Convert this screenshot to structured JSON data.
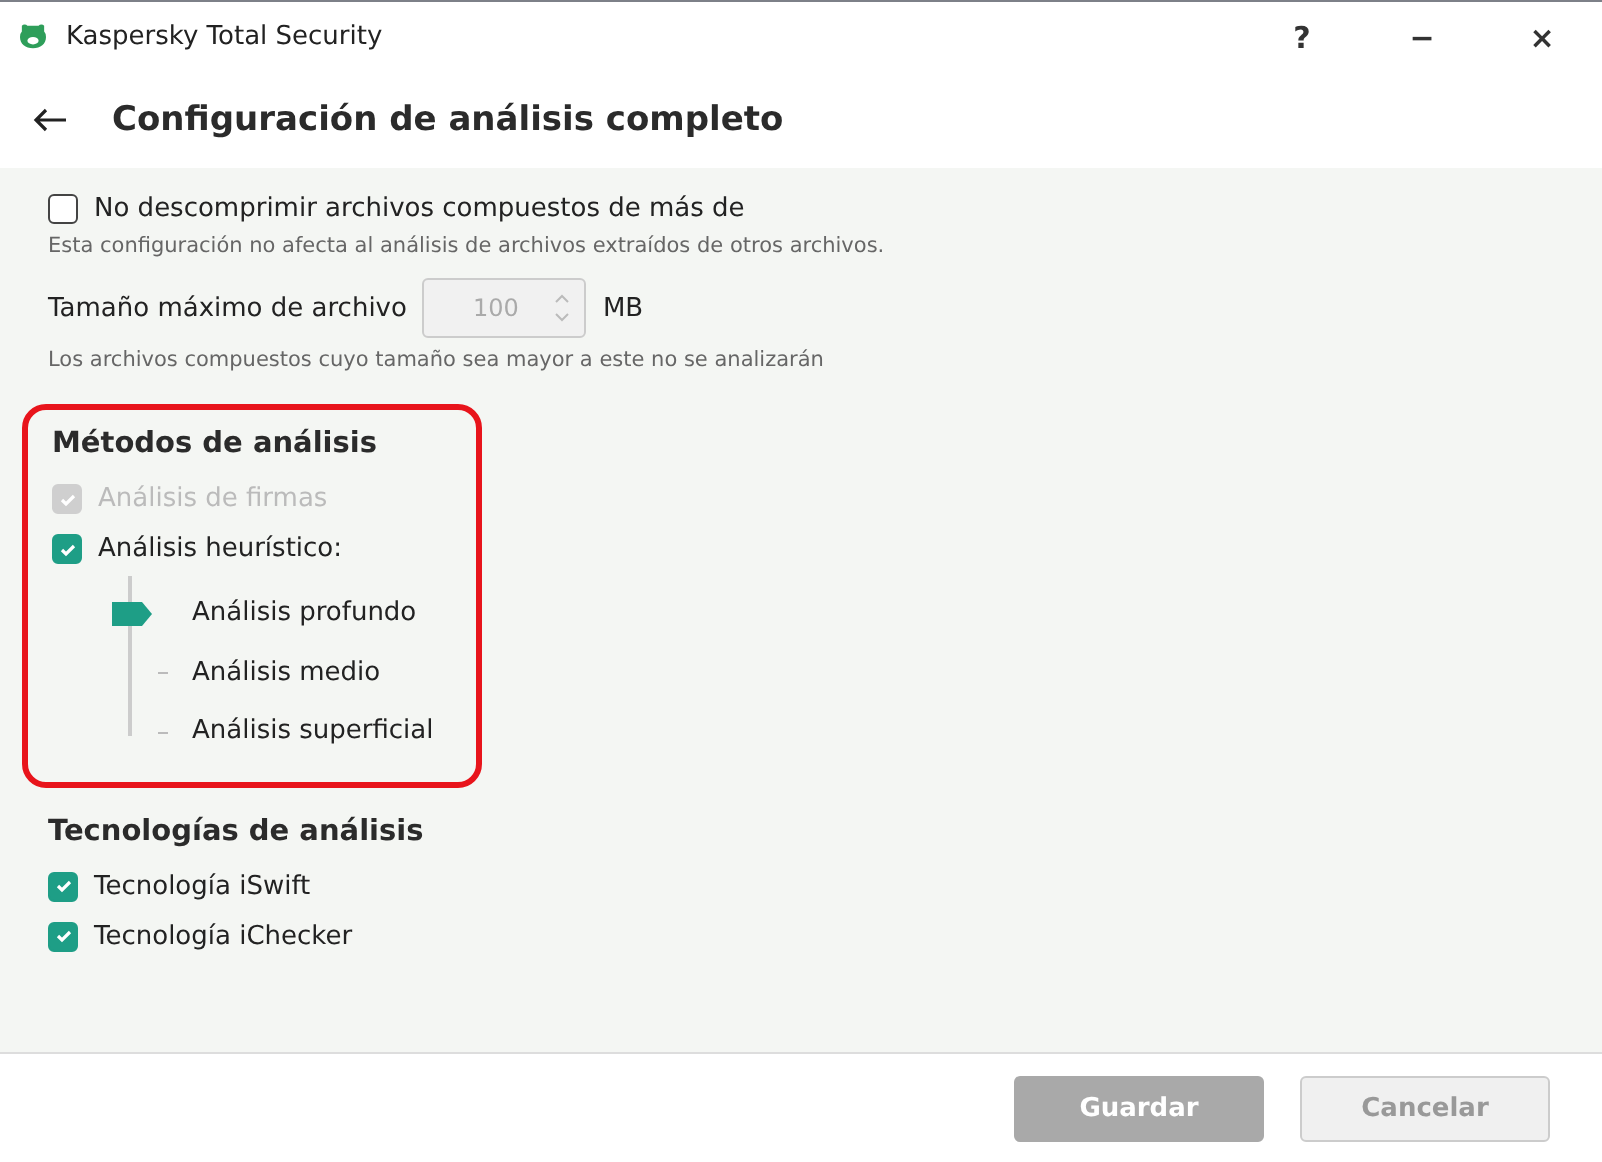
{
  "window": {
    "title": "Kaspersky Total Security",
    "controls": [
      "?",
      "−",
      "×"
    ]
  },
  "header": {
    "title": "Configuración de análisis completo"
  },
  "compressed": {
    "checkbox": {
      "label": "No descomprimir archivos compuestos de más de",
      "checked": false
    },
    "note": "Esta configuración no afecta al análisis de archivos extraídos de otros archivos.",
    "size_label": "Tamaño máximo de archivo",
    "size_value": "100",
    "size_disabled": true,
    "unit": "MB",
    "hint": "Los archivos compuestos cuyo tamaño sea mayor a este no se analizarán"
  },
  "methods": {
    "title": "Métodos de análisis",
    "highlighted": true,
    "options": [
      {
        "label": "Análisis de firmas",
        "checked": true,
        "disabled": true
      },
      {
        "label": "Análisis heurístico:",
        "checked": true,
        "disabled": false
      }
    ],
    "levels": [
      {
        "label": "Análisis profundo",
        "selected": true
      },
      {
        "label": "Análisis medio",
        "selected": false
      },
      {
        "label": "Análisis superficial",
        "selected": false
      }
    ]
  },
  "technologies": {
    "title": "Tecnologías de análisis",
    "options": [
      {
        "label": "Tecnología iSwift",
        "checked": true,
        "disabled": false
      },
      {
        "label": "Tecnología iChecker",
        "checked": true,
        "disabled": false
      }
    ]
  },
  "buttons": [
    {
      "label": "Guardar",
      "kind": "primary",
      "disabled": true
    },
    {
      "label": "Cancelar",
      "kind": "secondary",
      "disabled": true
    }
  ]
}
